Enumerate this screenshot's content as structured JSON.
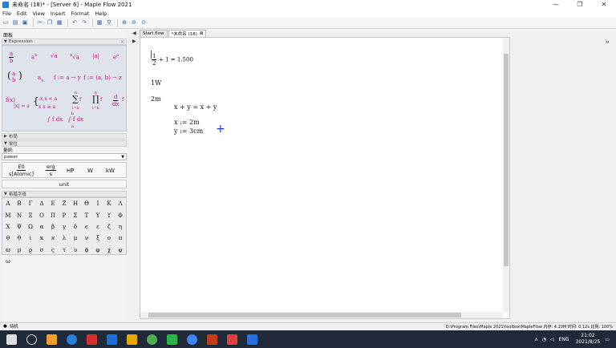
{
  "window": {
    "title": "未命名 (18)* - [Server 6] - Maple Flow 2021",
    "controls": [
      "—",
      "❐",
      "✕"
    ]
  },
  "menu": [
    "File",
    "Edit",
    "View",
    "Insert",
    "Format",
    "Help"
  ],
  "left": {
    "panel_title": "面板",
    "expression_header": "Expression",
    "palette": {
      "frac_num": "a",
      "frac_den": "b",
      "power": "a",
      "power_sup": "b",
      "sqrt": "√a",
      "nroot_index": "n",
      "nroot": "√a",
      "abs": "|a|",
      "exp": "e",
      "exp_sup": "a",
      "binom_top": "a",
      "binom_bot": "b",
      "sub": "a",
      "sub_idx": "n",
      "func1": "f := a → y",
      "func2": "f := (a, b) → z",
      "fx": "f(x)",
      "piece_lhs": "|x| = a",
      "piece1": "-x   x < a",
      "piece2": "x   x ≥ a",
      "sum": "∑",
      "sum_label": "f",
      "sum_lim": "i=k",
      "sum_top": "n",
      "prod": "∏",
      "prod_label": "f",
      "prod_lim": "i=k",
      "prod_top": "n",
      "deriv_num": "d",
      "deriv_den": "dx",
      "deriv_f": "f",
      "int": "∫ f dx",
      "defint": "∫ f dx",
      "defint_a": "a",
      "defint_b": "b"
    },
    "layout_header": "布局",
    "units_header": "单位",
    "units_label": "量纲:",
    "units_combo": "power",
    "units": [
      {
        "num": "E0",
        "den": "s[Atomic]"
      },
      {
        "num": "erg",
        "den": "s"
      },
      {
        "label": "HP"
      },
      {
        "label": "W"
      },
      {
        "label": "kW"
      }
    ],
    "unit_button": "unit",
    "greek_header": "希腊字母",
    "greek": [
      "Α",
      "Β",
      "Γ",
      "Δ",
      "Ε",
      "Ζ",
      "Η",
      "Θ",
      "Ι",
      "Κ",
      "Λ",
      "Μ",
      "Ν",
      "Ξ",
      "Ο",
      "Π",
      "Ρ",
      "Σ",
      "Τ",
      "Υ",
      "ϒ",
      "Φ",
      "Χ",
      "Ψ",
      "Ω",
      "α",
      "β",
      "γ",
      "δ",
      "ϵ",
      "ε",
      "ζ",
      "η",
      "θ",
      "ϑ",
      "ι",
      "κ",
      "ϰ",
      "λ",
      "μ",
      "ν",
      "ξ",
      "ο",
      "π",
      "ϖ",
      "ρ",
      "ϱ",
      "σ",
      "ς",
      "τ",
      "υ",
      "ϕ",
      "φ",
      "χ",
      "ψ",
      "ω"
    ]
  },
  "tabs": [
    {
      "label": "Start.flow",
      "active": false
    },
    {
      "label": "*未命名 (18)",
      "active": true
    }
  ],
  "document": {
    "eq1_num": "1",
    "eq1_den": "2",
    "eq1_rest": "+ 1 = 1.500",
    "line2": "1W",
    "line3": "2m",
    "eq_sym": "x + y = x + y",
    "assign_x": "x := 2m",
    "assign_y": "y := 3cm"
  },
  "status": {
    "left": "待机",
    "right": "D:\\Program Files\\Maple 2021\\toolbox\\MapleFlow  内存: 4.10M  时间: 0.12s  比例: 100%"
  },
  "taskbar": {
    "lang": "ENG",
    "time": "21:02",
    "date": "2021/8/25"
  }
}
